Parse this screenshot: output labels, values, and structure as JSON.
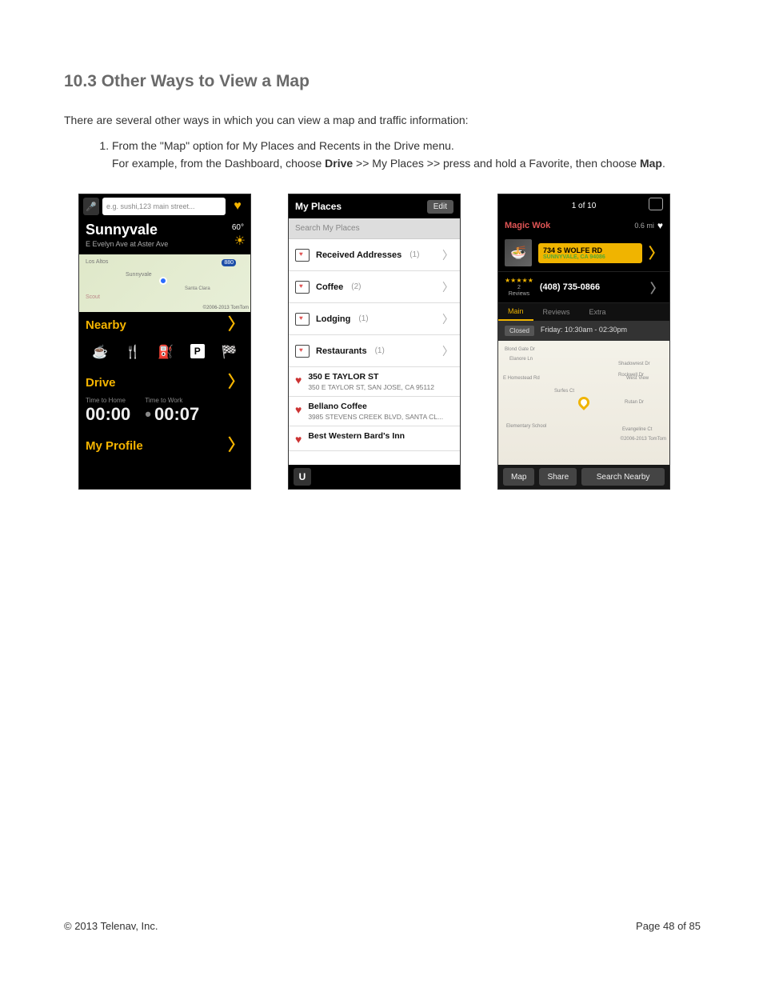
{
  "heading": "10.3 Other Ways to View a Map",
  "intro": "There are several other ways in which you can view a map and traffic information:",
  "steps": {
    "one": "From the \"Map\" option for My Places and Recents in the Drive menu."
  },
  "example": {
    "prefix": "For example, from the Dashboard, choose ",
    "b1": "Drive",
    "mid": " >> My Places >> press and hold a Favorite, then choose ",
    "b2": "Map",
    "suffix": "."
  },
  "phone1": {
    "search_placeholder": "e.g. sushi,123 main street...",
    "city": "Sunnyvale",
    "addr": "E Evelyn Ave at Aster Ave",
    "temp": "60°",
    "map_labels": {
      "losaltos": "Los Altos",
      "sunnyvale": "Sunnyvale",
      "santaclara": "Santa Clara",
      "scout": "Scout",
      "hwy": "880",
      "tm": "©2006-2013 TomTom"
    },
    "nearby": "Nearby",
    "drive": "Drive",
    "time_home_label": "Time to Home",
    "time_home_value": "00:00",
    "time_work_label": "Time to Work",
    "time_work_value": "00:07",
    "myprofile": "My Profile"
  },
  "phone2": {
    "title": "My Places",
    "edit": "Edit",
    "search_placeholder": "Search My Places",
    "folders": [
      {
        "name": "Received Addresses",
        "count": "(1)"
      },
      {
        "name": "Coffee",
        "count": "(2)"
      },
      {
        "name": "Lodging",
        "count": "(1)"
      },
      {
        "name": "Restaurants",
        "count": "(1)"
      }
    ],
    "places": [
      {
        "name": "350 E TAYLOR ST",
        "addr": "350 E TAYLOR ST, SAN JOSE, CA 95112"
      },
      {
        "name": "Bellano Coffee",
        "addr": "3985 STEVENS CREEK BLVD, SANTA CL..."
      },
      {
        "name": "Best Western Bard's Inn",
        "addr": ""
      }
    ],
    "logo": "U"
  },
  "phone3": {
    "pager": "1 of 10",
    "name": "Magic Wok",
    "distance": "0.6 mi",
    "addr_l1": "734 S WOLFE RD",
    "addr_l2": "SUNNYVALE, CA 94086",
    "stars": "★★★★★",
    "review_count": "2",
    "review_label": "Reviews",
    "phone": "(408) 735-0866",
    "tabs": {
      "main": "Main",
      "reviews": "Reviews",
      "extra": "Extra"
    },
    "status": "Closed",
    "hours": "Friday: 10:30am - 02:30pm",
    "map_copyright": "©2006-2013 TomTom",
    "buttons": {
      "map": "Map",
      "share": "Share",
      "search": "Search Nearby"
    }
  },
  "footer": {
    "copyright": "© 2013 Telenav, Inc.",
    "page": "Page 48 of 85"
  }
}
